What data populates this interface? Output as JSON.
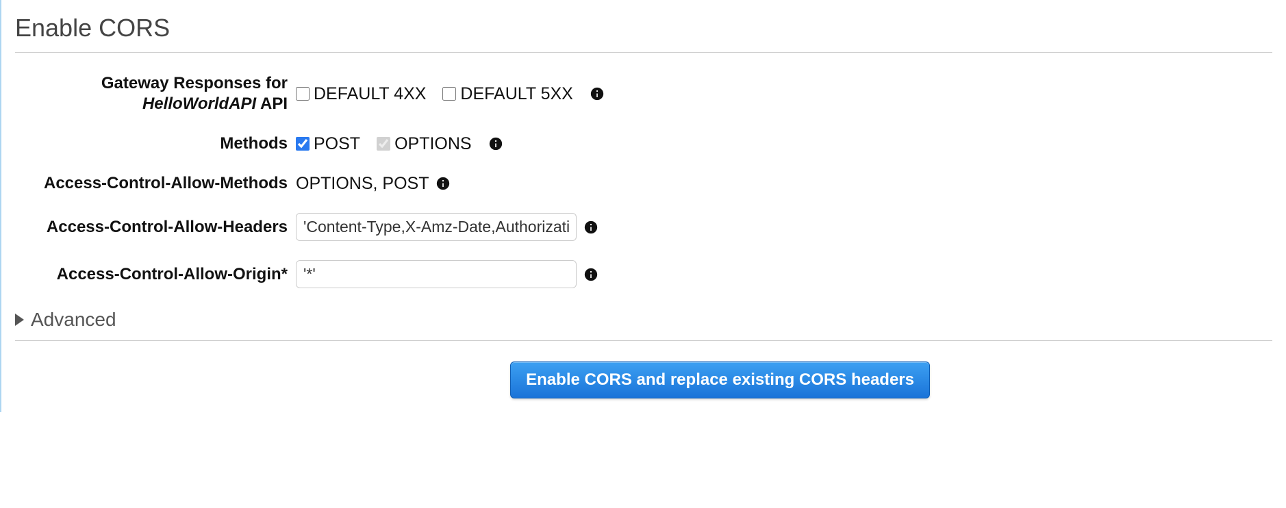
{
  "page_title": "Enable CORS",
  "api_name": "HelloWorldAPI",
  "labels": {
    "gateway_responses_prefix": "Gateway Responses for ",
    "gateway_responses_suffix": " API",
    "methods": "Methods",
    "allow_methods": "Access-Control-Allow-Methods",
    "allow_headers": "Access-Control-Allow-Headers",
    "allow_origin": "Access-Control-Allow-Origin*"
  },
  "gateway_responses": {
    "default_4xx": {
      "label": "DEFAULT 4XX",
      "checked": false
    },
    "default_5xx": {
      "label": "DEFAULT 5XX",
      "checked": false
    }
  },
  "methods": {
    "post": {
      "label": "POST",
      "checked": true,
      "disabled": false
    },
    "options": {
      "label": "OPTIONS",
      "checked": true,
      "disabled": true
    }
  },
  "allow_methods_value": "OPTIONS, POST",
  "allow_headers_value": "'Content-Type,X-Amz-Date,Authorizatio",
  "allow_origin_value": "'*'",
  "advanced_label": "Advanced",
  "submit_button_label": "Enable CORS and replace existing CORS headers"
}
